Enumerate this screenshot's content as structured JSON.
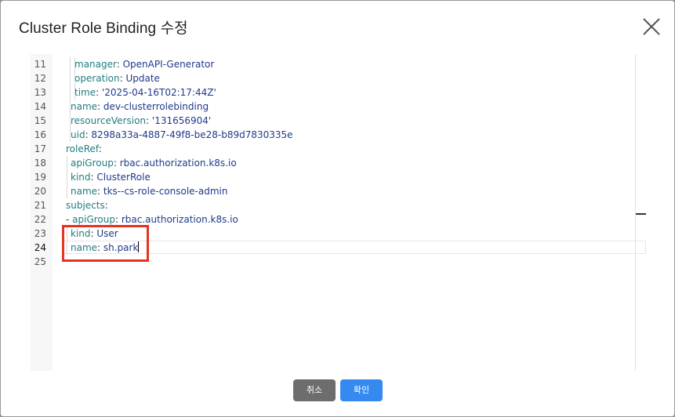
{
  "dialog": {
    "title": "Cluster Role Binding 수정",
    "close_icon": "close-icon"
  },
  "editor": {
    "active_line": "24",
    "lines": [
      {
        "n": "11",
        "indent": 3,
        "key": "manager",
        "value": "OpenAPI-Generator"
      },
      {
        "n": "12",
        "indent": 3,
        "key": "operation",
        "value": "Update"
      },
      {
        "n": "13",
        "indent": 3,
        "key": "time",
        "value": "'2025-04-16T02:17:44Z'"
      },
      {
        "n": "14",
        "indent": 2,
        "key": "name",
        "value": "dev-clusterrolebinding"
      },
      {
        "n": "15",
        "indent": 2,
        "key": "resourceVersion",
        "value": "'131656904'"
      },
      {
        "n": "16",
        "indent": 2,
        "key": "uid",
        "value": "8298a33a-4887-49f8-be28-b89d7830335e"
      },
      {
        "n": "17",
        "indent": 1,
        "key": "roleRef",
        "value": ""
      },
      {
        "n": "18",
        "indent": 2,
        "key": "apiGroup",
        "value": "rbac.authorization.k8s.io"
      },
      {
        "n": "19",
        "indent": 2,
        "key": "kind",
        "value": "ClusterRole"
      },
      {
        "n": "20",
        "indent": 2,
        "key": "name",
        "value": "tks--cs-role-console-admin"
      },
      {
        "n": "21",
        "indent": 1,
        "key": "subjects",
        "value": ""
      },
      {
        "n": "22",
        "indent": 1,
        "key": "- apiGroup",
        "value": "rbac.authorization.k8s.io"
      },
      {
        "n": "23",
        "indent": 2,
        "key": "kind",
        "value": "User"
      },
      {
        "n": "24",
        "indent": 2,
        "key": "name",
        "value": "sh.park"
      },
      {
        "n": "25",
        "indent": 0,
        "key": "",
        "value": ""
      }
    ]
  },
  "footer": {
    "cancel_label": "취소",
    "confirm_label": "확인"
  },
  "colors": {
    "yaml_key": "#217d80",
    "yaml_value": "#1f3a8a",
    "confirm_button": "#3589f0",
    "cancel_button": "#6d6d6d",
    "highlight_box": "#e8321f"
  }
}
